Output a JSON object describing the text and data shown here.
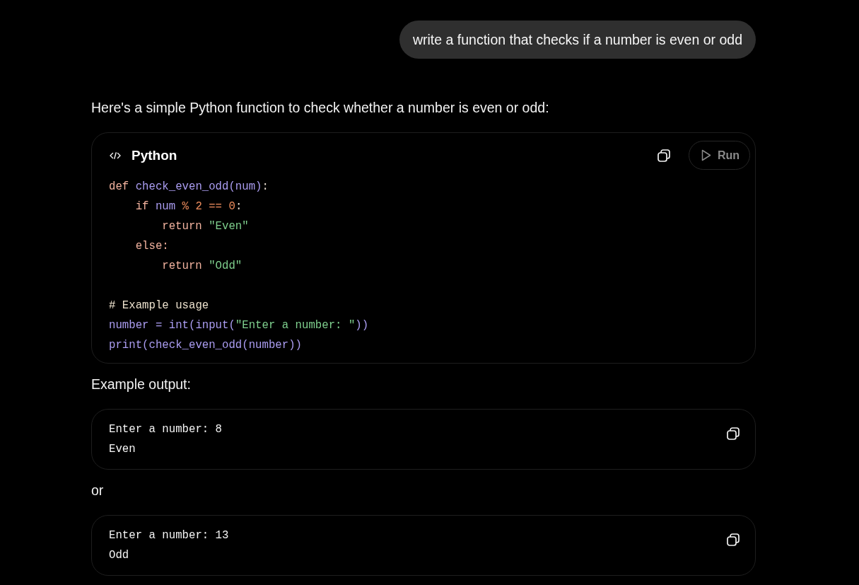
{
  "user_message": {
    "text": "write a function that checks if a number is even or odd"
  },
  "response": [
    {
      "kind": "paragraph",
      "text": "Here's a simple Python function to check whether a number is even or odd:"
    },
    {
      "kind": "code",
      "language": "Python",
      "run_button": {
        "label": "Run",
        "disabled": true
      },
      "sections": [
        [
          {
            "tokens": [
              {
                "kind": "keyword",
                "text": "def "
              },
              {
                "kind": "name",
                "text": "check_even_odd(num)"
              },
              {
                "kind": "plain",
                "text": ":"
              }
            ],
            "children": [
              {
                "tokens": [
                  {
                    "kind": "keyword",
                    "text": "if "
                  },
                  {
                    "kind": "name",
                    "text": "num "
                  },
                  {
                    "kind": "operator",
                    "text": "% "
                  },
                  {
                    "kind": "number",
                    "text": "2 "
                  },
                  {
                    "kind": "operator",
                    "text": "== "
                  },
                  {
                    "kind": "number",
                    "text": "0"
                  },
                  {
                    "kind": "plain",
                    "text": ":"
                  }
                ],
                "children": [
                  {
                    "tokens": [
                      {
                        "kind": "keyword",
                        "text": "return "
                      },
                      {
                        "kind": "string",
                        "text": "\"Even\""
                      }
                    ]
                  }
                ]
              },
              {
                "tokens": [
                  {
                    "kind": "keyword",
                    "text": "else:"
                  }
                ],
                "children": [
                  {
                    "tokens": [
                      {
                        "kind": "keyword",
                        "text": "return "
                      },
                      {
                        "kind": "string",
                        "text": "\"Odd\""
                      }
                    ]
                  }
                ]
              }
            ]
          }
        ],
        [
          {
            "tokens": [
              {
                "kind": "comment",
                "text": "# Example usage"
              }
            ]
          },
          {
            "tokens": [
              {
                "kind": "name",
                "text": "number = int(input("
              },
              {
                "kind": "string",
                "text": "\"Enter a number: \""
              },
              {
                "kind": "name",
                "text": "))"
              }
            ]
          },
          {
            "tokens": [
              {
                "kind": "name",
                "text": "print(check_even_odd(number))"
              }
            ]
          }
        ]
      ]
    },
    {
      "kind": "paragraph",
      "text": "Example output:"
    },
    {
      "kind": "output",
      "lines": [
        "Enter a number: 8",
        "Even"
      ]
    },
    {
      "kind": "paragraph",
      "text": "or"
    },
    {
      "kind": "output",
      "lines": [
        "Enter a number: 13",
        "Odd"
      ]
    }
  ]
}
